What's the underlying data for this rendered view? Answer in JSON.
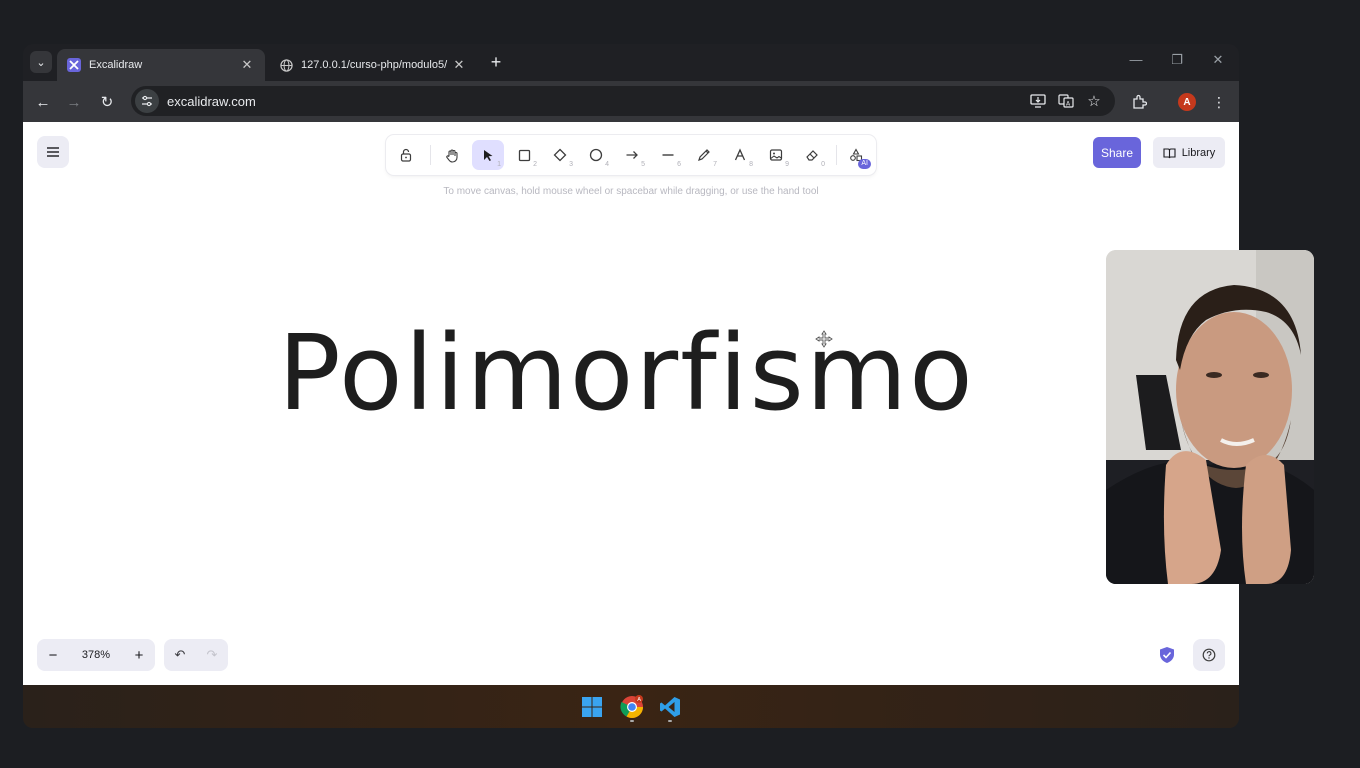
{
  "browser": {
    "tabs": [
      {
        "title": "Excalidraw",
        "active": true
      },
      {
        "title": "127.0.0.1/curso-php/modulo5/",
        "active": false
      }
    ],
    "url": "excalidraw.com",
    "avatar_letter": "A"
  },
  "toolbar": {
    "tools": [
      {
        "name": "lock",
        "key": ""
      },
      {
        "name": "hand",
        "key": ""
      },
      {
        "name": "selection",
        "key": "1",
        "selected": true
      },
      {
        "name": "rectangle",
        "key": "2"
      },
      {
        "name": "diamond",
        "key": "3"
      },
      {
        "name": "ellipse",
        "key": "4"
      },
      {
        "name": "arrow",
        "key": "5"
      },
      {
        "name": "line",
        "key": "6"
      },
      {
        "name": "draw",
        "key": "7"
      },
      {
        "name": "text",
        "key": "8"
      },
      {
        "name": "image",
        "key": "9"
      },
      {
        "name": "eraser",
        "key": "0"
      },
      {
        "name": "more-tools",
        "badge": "AI"
      }
    ]
  },
  "canvas": {
    "hint": "To move canvas, hold mouse wheel or spacebar while dragging, or use the hand tool",
    "text": "Polimorfismo"
  },
  "header": {
    "share_label": "Share",
    "library_label": "Library"
  },
  "footer": {
    "zoom_value": "378%",
    "zoom_out": "−",
    "zoom_in": "+"
  },
  "colors": {
    "accent": "#6965db",
    "selected_tool_bg": "#e0dfff"
  }
}
